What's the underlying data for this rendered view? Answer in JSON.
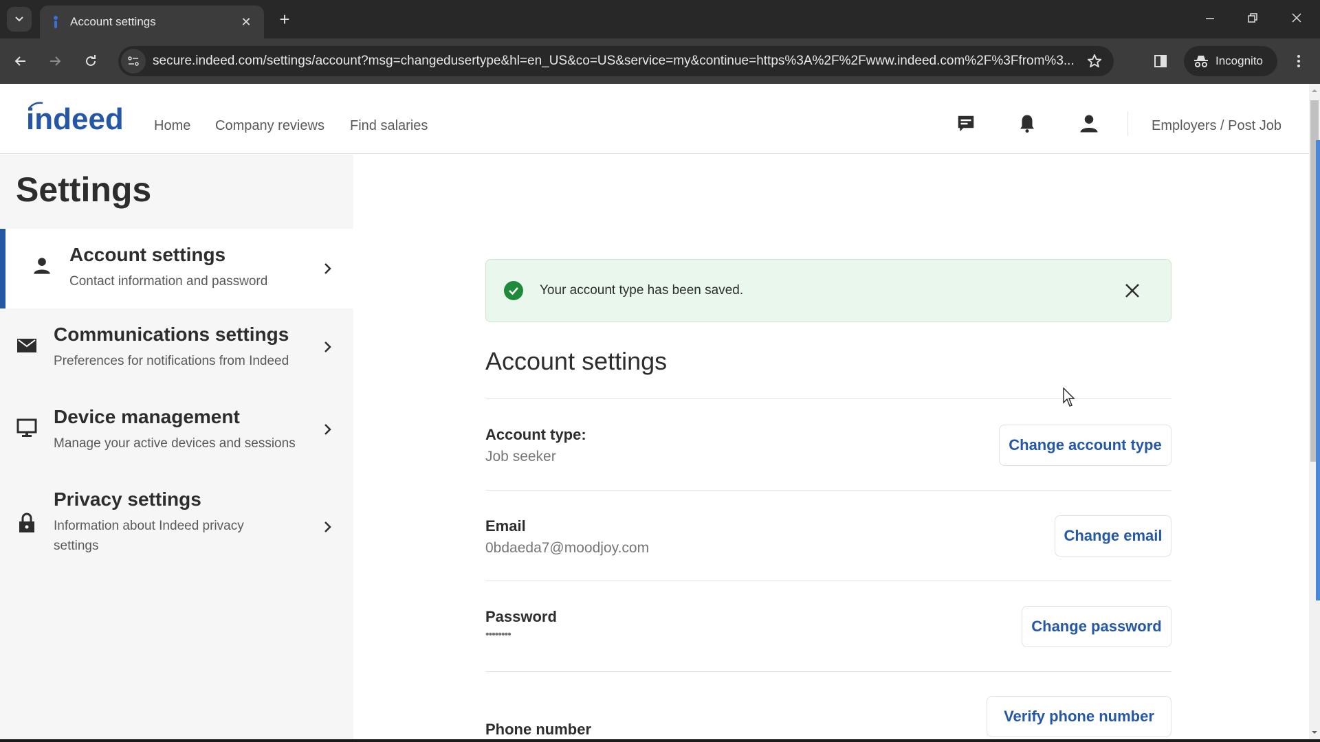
{
  "browser": {
    "tab_title": "Account settings",
    "url": "secure.indeed.com/settings/account?msg=changedusertype&hl=en_US&co=US&service=my&continue=https%3A%2F%2Fwww.indeed.com%2F%3Ffrom%3...",
    "incognito_label": "Incognito",
    "new_tab_glyph": "+",
    "tab_close_glyph": "✕",
    "minimize_glyph": "—",
    "close_glyph": "✕"
  },
  "header": {
    "logo_text": "indeed",
    "nav": [
      "Home",
      "Company reviews",
      "Find salaries"
    ],
    "employers_link": "Employers / Post Job"
  },
  "sidebar": {
    "title": "Settings",
    "items": [
      {
        "label": "Account settings",
        "description": "Contact information and password",
        "icon": "person-icon",
        "active": true
      },
      {
        "label": "Communications settings",
        "description": "Preferences for notifications from Indeed",
        "icon": "envelope-icon",
        "active": false
      },
      {
        "label": "Device management",
        "description": "Manage your active devices and sessions",
        "icon": "monitor-icon",
        "active": false
      },
      {
        "label": "Privacy settings",
        "description": "Information about Indeed privacy settings",
        "icon": "lock-icon",
        "active": false
      }
    ]
  },
  "main": {
    "alert_message": "Your account type has been saved.",
    "section_title": "Account settings",
    "rows": [
      {
        "label": "Account type:",
        "value": "Job seeker",
        "button": "Change account type"
      },
      {
        "label": "Email",
        "value": "0bdaeda7@moodjoy.com",
        "button": "Change email"
      },
      {
        "label": "Password",
        "value": "••••••••",
        "button": "Change password"
      },
      {
        "label": "Phone number",
        "value": "",
        "button": "Verify phone number"
      }
    ]
  },
  "colors": {
    "brand_blue": "#2557a7",
    "success_green": "#1f8a3b",
    "alert_bg": "#e9f7ec"
  }
}
